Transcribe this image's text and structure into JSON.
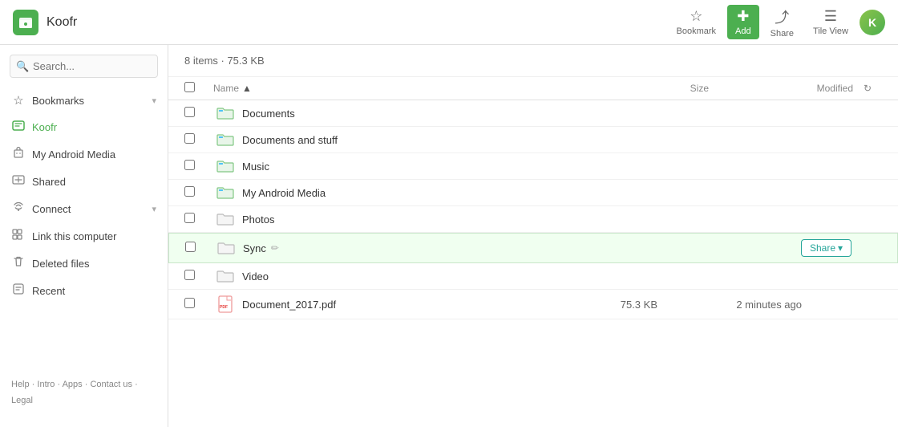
{
  "app": {
    "name": "Koofr",
    "logo_char": "🗂"
  },
  "topbar": {
    "bookmark_label": "Bookmark",
    "add_label": "Add",
    "share_label": "Share",
    "tile_view_label": "Tile View"
  },
  "sidebar": {
    "search_placeholder": "Search...",
    "items": [
      {
        "id": "bookmarks",
        "label": "Bookmarks",
        "icon": "☆",
        "has_chevron": true
      },
      {
        "id": "koofr",
        "label": "Koofr",
        "icon": "🔒",
        "has_chevron": false,
        "active": true
      },
      {
        "id": "android",
        "label": "My Android Media",
        "icon": "📱",
        "has_chevron": false
      },
      {
        "id": "shared",
        "label": "Shared",
        "icon": "🔗",
        "has_chevron": false
      },
      {
        "id": "connect",
        "label": "Connect",
        "icon": "📡",
        "has_chevron": true
      },
      {
        "id": "link-computer",
        "label": "Link this computer",
        "icon": "⊞",
        "has_chevron": false
      },
      {
        "id": "deleted",
        "label": "Deleted files",
        "icon": "🗑",
        "has_chevron": false
      },
      {
        "id": "recent",
        "label": "Recent",
        "icon": "🔒",
        "has_chevron": false
      }
    ],
    "footer": {
      "links": [
        "Help",
        "Intro",
        "Apps",
        "Contact us",
        "Legal"
      ]
    }
  },
  "content": {
    "summary": "8 items · 75.3 KB",
    "columns": {
      "name": "Name",
      "size": "Size",
      "modified": "Modified"
    },
    "files": [
      {
        "id": "documents",
        "name": "Documents",
        "type": "folder-colored",
        "size": "",
        "modified": ""
      },
      {
        "id": "documents-stuff",
        "name": "Documents and stuff",
        "type": "folder-colored",
        "size": "",
        "modified": ""
      },
      {
        "id": "music",
        "name": "Music",
        "type": "folder-colored",
        "size": "",
        "modified": ""
      },
      {
        "id": "android-media",
        "name": "My Android Media",
        "type": "folder-colored",
        "size": "",
        "modified": ""
      },
      {
        "id": "photos",
        "name": "Photos",
        "type": "folder-plain",
        "size": "",
        "modified": ""
      },
      {
        "id": "sync",
        "name": "Sync",
        "type": "folder-plain",
        "size": "",
        "modified": "",
        "selected": true,
        "show_share": true,
        "editable": true
      },
      {
        "id": "video",
        "name": "Video",
        "type": "folder-plain",
        "size": "",
        "modified": ""
      },
      {
        "id": "document-pdf",
        "name": "Document_2017.pdf",
        "type": "pdf",
        "size": "75.3 KB",
        "modified": "2 minutes ago"
      }
    ],
    "share_button_label": "Share",
    "share_chevron": "▾"
  }
}
